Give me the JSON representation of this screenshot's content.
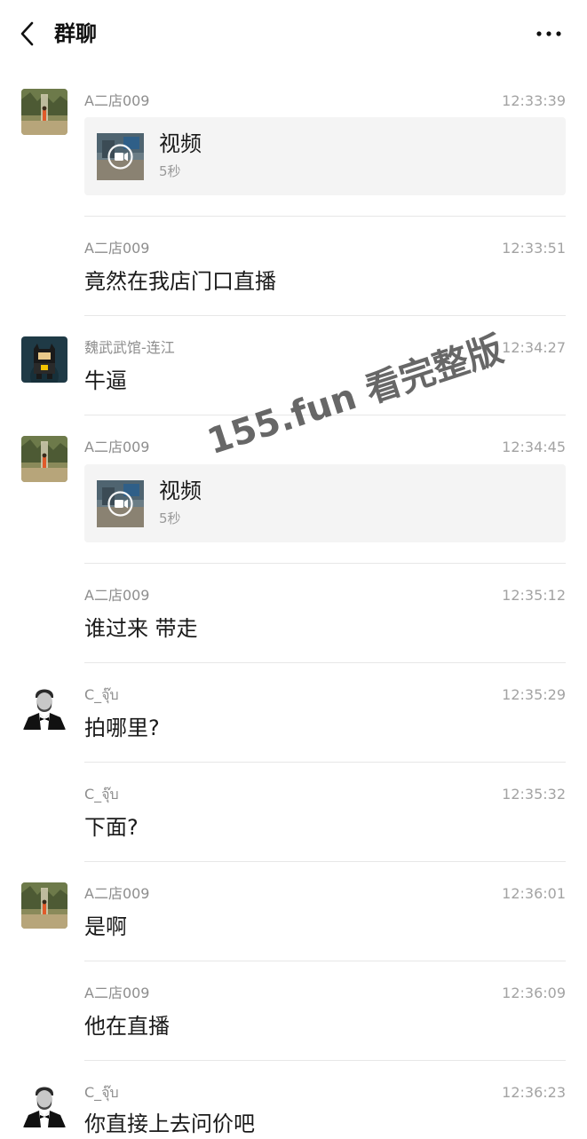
{
  "header": {
    "title": "群聊",
    "back_icon": "chevron-left-icon",
    "more_icon": "ellipsis-icon"
  },
  "watermark": "155.fun 看完整版",
  "messages": [
    {
      "sender": "A二店009",
      "time": "12:33:39",
      "avatar": "landscape-avatar",
      "video": {
        "title": "视频",
        "duration": "5秒"
      }
    },
    {
      "sender": "A二店009",
      "time": "12:33:51",
      "text": "竟然在我店门口直播"
    },
    {
      "sender": "魏武武馆-连江",
      "time": "12:34:27",
      "avatar": "batman-avatar",
      "text": "牛逼"
    },
    {
      "sender": "A二店009",
      "time": "12:34:45",
      "avatar": "landscape-avatar",
      "video": {
        "title": "视频",
        "duration": "5秒"
      }
    },
    {
      "sender": "A二店009",
      "time": "12:35:12",
      "text": "谁过来 带走"
    },
    {
      "sender": "C_จุ๊บ",
      "time": "12:35:29",
      "avatar": "tuxedo-man-avatar",
      "text": "拍哪里?"
    },
    {
      "sender": "C_จุ๊บ",
      "time": "12:35:32",
      "text": "下面?"
    },
    {
      "sender": "A二店009",
      "time": "12:36:01",
      "avatar": "landscape-avatar",
      "text": "是啊"
    },
    {
      "sender": "A二店009",
      "time": "12:36:09",
      "text": "他在直播"
    },
    {
      "sender": "C_จุ๊บ",
      "time": "12:36:23",
      "avatar": "tuxedo-man-avatar",
      "text": "你直接上去问价吧"
    }
  ]
}
